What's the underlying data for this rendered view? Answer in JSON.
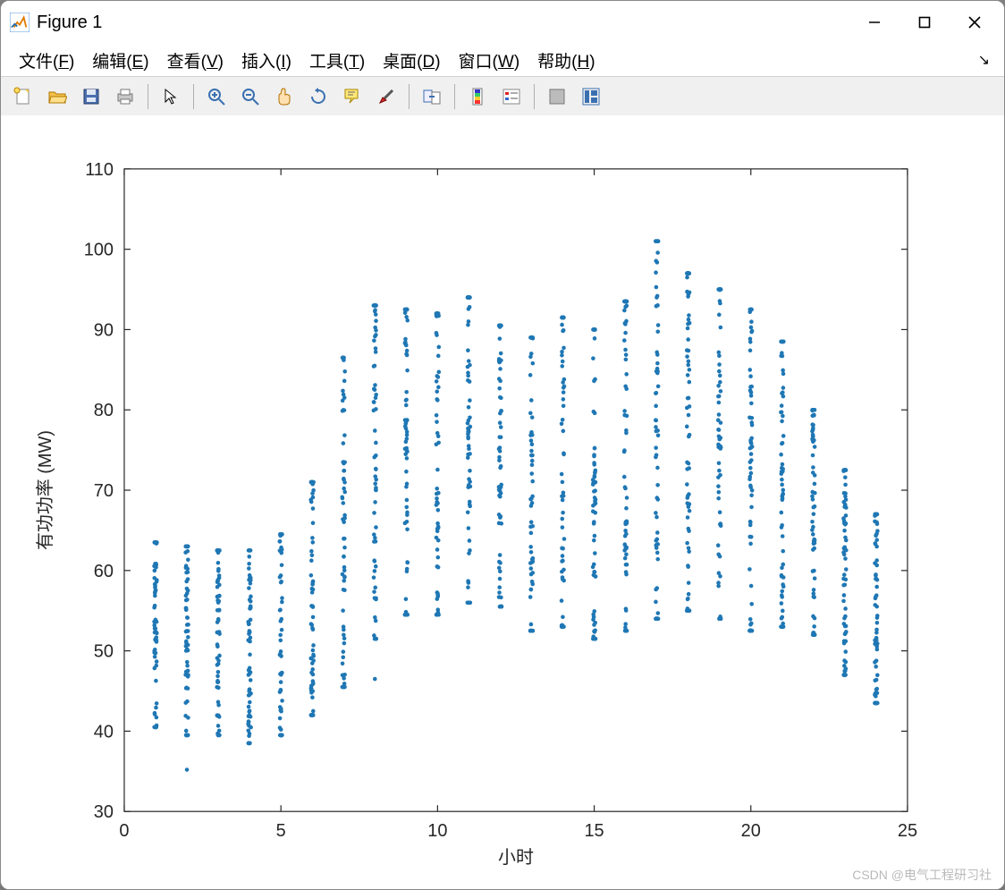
{
  "window": {
    "title": "Figure 1"
  },
  "menu": [
    {
      "label": "文件(F)"
    },
    {
      "label": "编辑(E)"
    },
    {
      "label": "查看(V)"
    },
    {
      "label": "插入(I)"
    },
    {
      "label": "工具(T)"
    },
    {
      "label": "桌面(D)"
    },
    {
      "label": "窗口(W)"
    },
    {
      "label": "帮助(H)"
    }
  ],
  "toolbar_icons": [
    "new",
    "open",
    "save",
    "print",
    "pointer",
    "zoom-in",
    "zoom-out",
    "pan",
    "rotate",
    "data-cursor",
    "brush",
    "link",
    "colorbar",
    "legend",
    "hide-plot-tools",
    "show-plot-tools"
  ],
  "watermark": "CSDN @电气工程研习社",
  "chart_data": {
    "type": "scatter",
    "xlabel": "小时",
    "ylabel": "有功功率 (MW)",
    "title": "",
    "xlim": [
      0,
      25
    ],
    "ylim": [
      30,
      110
    ],
    "xticks": [
      0,
      5,
      10,
      15,
      20,
      25
    ],
    "yticks": [
      30,
      40,
      50,
      60,
      70,
      80,
      90,
      100,
      110
    ],
    "marker_color": "#1f77b4",
    "series": [
      {
        "x": 1,
        "ymin": 40.5,
        "ymax": 63.5,
        "outliers": []
      },
      {
        "x": 2,
        "ymin": 39.5,
        "ymax": 63.0,
        "outliers": [
          35.2
        ]
      },
      {
        "x": 3,
        "ymin": 39.5,
        "ymax": 62.5,
        "outliers": []
      },
      {
        "x": 4,
        "ymin": 38.5,
        "ymax": 62.5,
        "outliers": []
      },
      {
        "x": 5,
        "ymin": 39.5,
        "ymax": 64.5,
        "outliers": []
      },
      {
        "x": 6,
        "ymin": 42.0,
        "ymax": 71.0,
        "outliers": []
      },
      {
        "x": 7,
        "ymin": 45.5,
        "ymax": 86.5,
        "outliers": []
      },
      {
        "x": 8,
        "ymin": 51.5,
        "ymax": 93.0,
        "outliers": [
          46.5
        ]
      },
      {
        "x": 9,
        "ymin": 54.5,
        "ymax": 92.5,
        "outliers": []
      },
      {
        "x": 10,
        "ymin": 54.5,
        "ymax": 92.0,
        "outliers": []
      },
      {
        "x": 11,
        "ymin": 56.0,
        "ymax": 94.0,
        "outliers": []
      },
      {
        "x": 12,
        "ymin": 55.5,
        "ymax": 90.5,
        "outliers": []
      },
      {
        "x": 13,
        "ymin": 52.5,
        "ymax": 89.0,
        "outliers": []
      },
      {
        "x": 14,
        "ymin": 53.0,
        "ymax": 91.5,
        "outliers": []
      },
      {
        "x": 15,
        "ymin": 51.5,
        "ymax": 90.0,
        "outliers": []
      },
      {
        "x": 16,
        "ymin": 52.5,
        "ymax": 93.5,
        "outliers": []
      },
      {
        "x": 17,
        "ymin": 54.0,
        "ymax": 101.0,
        "outliers": []
      },
      {
        "x": 18,
        "ymin": 55.0,
        "ymax": 97.0,
        "outliers": []
      },
      {
        "x": 19,
        "ymin": 54.0,
        "ymax": 95.0,
        "outliers": []
      },
      {
        "x": 20,
        "ymin": 52.5,
        "ymax": 92.5,
        "outliers": []
      },
      {
        "x": 21,
        "ymin": 53.0,
        "ymax": 88.5,
        "outliers": []
      },
      {
        "x": 22,
        "ymin": 52.0,
        "ymax": 80.0,
        "outliers": []
      },
      {
        "x": 23,
        "ymin": 47.0,
        "ymax": 72.5,
        "outliers": []
      },
      {
        "x": 24,
        "ymin": 43.5,
        "ymax": 67.0,
        "outliers": []
      }
    ]
  }
}
